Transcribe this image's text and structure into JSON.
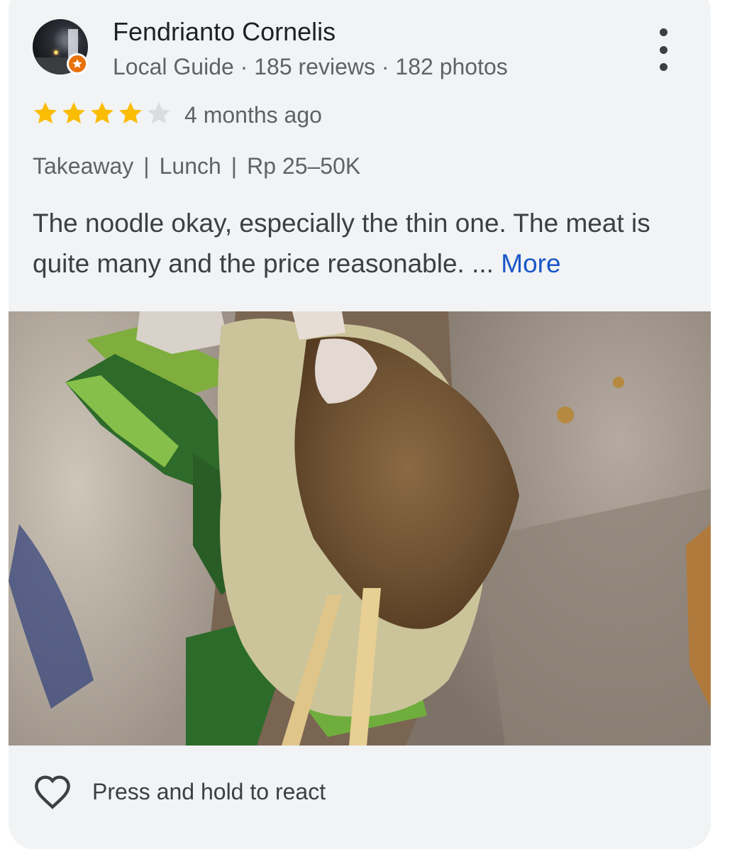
{
  "reviewer": {
    "name": "Fendrianto Cornelis",
    "meta": "Local Guide · 185 reviews · 182 photos",
    "avatar_icon": "user-avatar",
    "badge_icon": "local-guide-star-icon",
    "badge_color": "#e8710a"
  },
  "menu": {
    "icon": "more-vert-icon"
  },
  "rating": {
    "stars": 4,
    "max": 5,
    "filled_color": "#fbbc04",
    "empty_color": "#dadce0",
    "time": "4 months ago"
  },
  "tags": {
    "service": "Takeaway",
    "meal": "Lunch",
    "price": "Rp 25–50K",
    "separator": "|"
  },
  "review": {
    "text": "The noodle okay, especially the thin one. The meat is quite many and the price reasonable. ...",
    "more_label": "More",
    "link_color": "#1a57c8"
  },
  "photo": {
    "icon": "food-photo"
  },
  "reaction": {
    "icon": "heart-outline-icon",
    "label": "Press and hold to react"
  }
}
